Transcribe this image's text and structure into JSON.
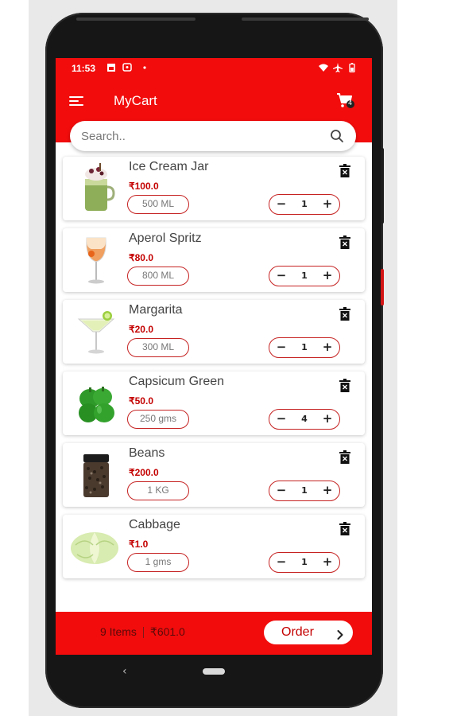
{
  "status_bar": {
    "time": "11:53"
  },
  "app_bar": {
    "title": "MyCart",
    "cart_badge": "4"
  },
  "search": {
    "placeholder": "Search.."
  },
  "cart_items": [
    {
      "name": "Ice Cream Jar",
      "price": "₹100.0",
      "size": "500 ML",
      "qty": "1",
      "image": "ice-cream-jar-image"
    },
    {
      "name": "Aperol Spritz",
      "price": "₹80.0",
      "size": "800 ML",
      "qty": "1",
      "image": "aperol-spritz-image"
    },
    {
      "name": "Margarita",
      "price": "₹20.0",
      "size": "300 ML",
      "qty": "1",
      "image": "margarita-image"
    },
    {
      "name": "Capsicum Green",
      "price": "₹50.0",
      "size": "250 gms",
      "qty": "4",
      "image": "capsicum-image"
    },
    {
      "name": "Beans",
      "price": "₹200.0",
      "size": "1 KG",
      "qty": "1",
      "image": "beans-jar-image"
    },
    {
      "name": "Cabbage",
      "price": "₹1.0",
      "size": "1 gms",
      "qty": "1",
      "image": "cabbage-image"
    }
  ],
  "stepper": {
    "minus": "−",
    "plus": "+"
  },
  "bottom_bar": {
    "items_count": "9 Items",
    "total": "₹601.0",
    "order_label": "Order"
  },
  "nav": {
    "back": "‹"
  },
  "colors": {
    "primary_red": "#f20c0c",
    "price_red": "#c40000",
    "outline_red": "#c62222"
  }
}
